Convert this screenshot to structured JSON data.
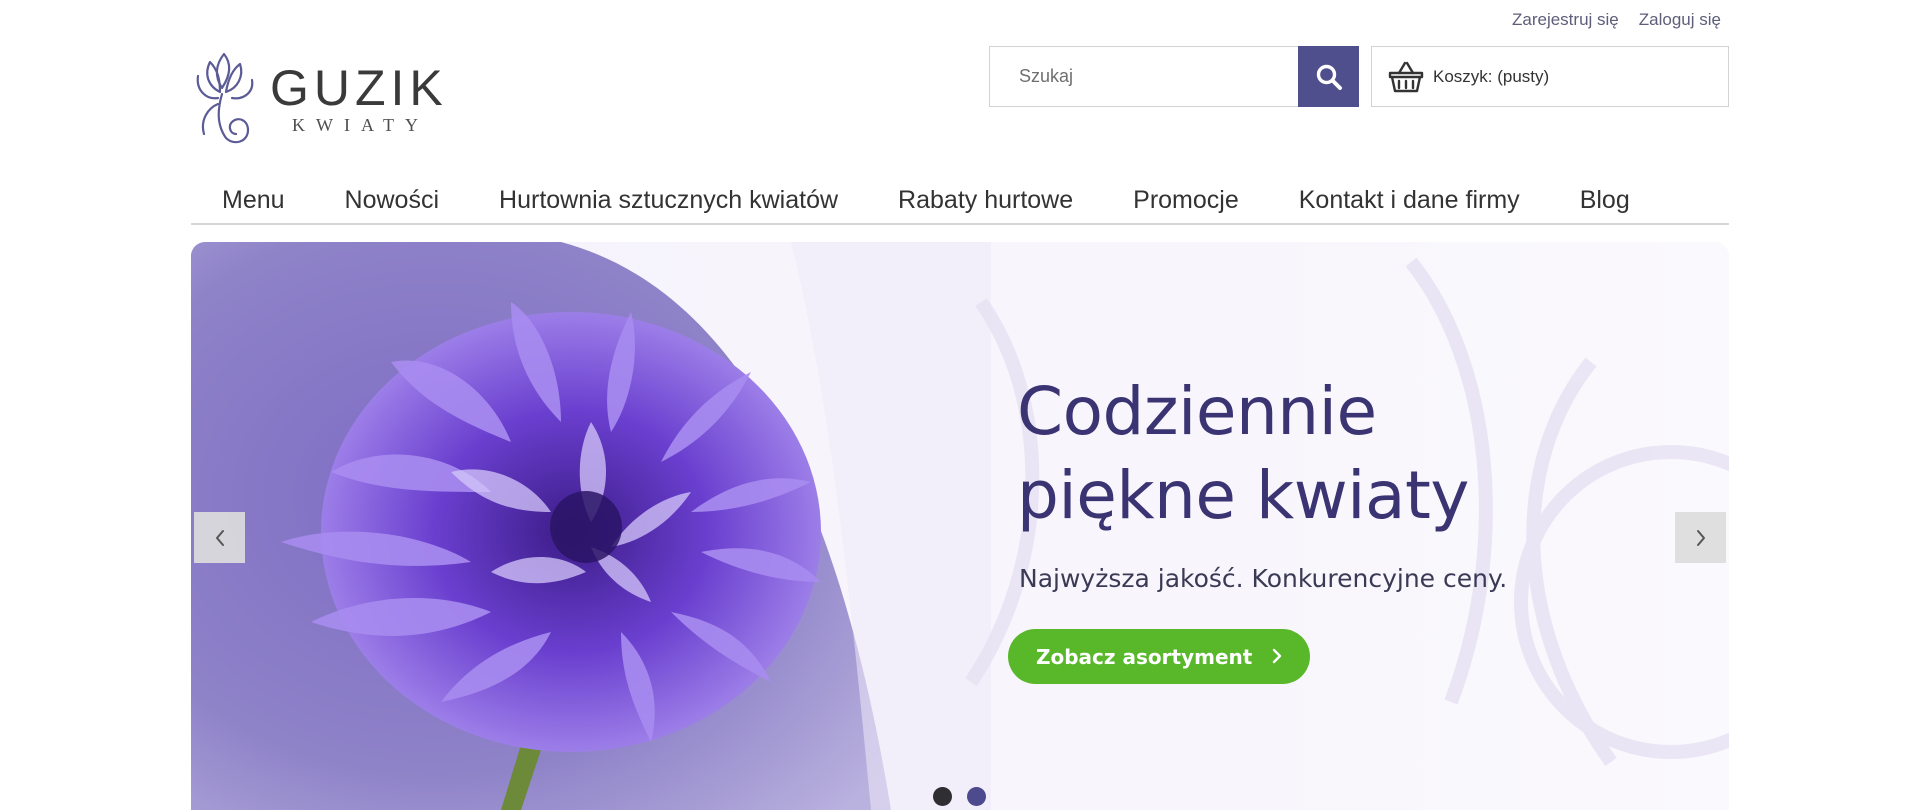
{
  "header": {
    "register_label": "Zarejestruj się",
    "login_label": "Zaloguj się"
  },
  "logo": {
    "title": "GUZIK",
    "subtitle": "KWIATY"
  },
  "search": {
    "placeholder": "Szukaj",
    "value": ""
  },
  "cart": {
    "label": "Koszyk: (pusty)"
  },
  "nav": {
    "items": [
      {
        "label": "Menu"
      },
      {
        "label": "Nowości"
      },
      {
        "label": "Hurtownia sztucznych kwiatów"
      },
      {
        "label": "Rabaty hurtowe"
      },
      {
        "label": "Promocje"
      },
      {
        "label": "Kontakt i dane firmy"
      },
      {
        "label": "Blog"
      }
    ]
  },
  "slider": {
    "headline_line1": "Codziennie",
    "headline_line2": "piękne kwiaty",
    "tagline": "Najwyższa jakość. Konkurencyjne ceny.",
    "cta_label": "Zobacz asortyment",
    "active_slide": 2,
    "slide_count": 2
  },
  "colors": {
    "brand_purple": "#4f4f8e",
    "headline": "#3b3473",
    "cta_green": "#58b829"
  },
  "icons": {
    "search": "search-icon",
    "cart": "basket-icon",
    "prev": "chevron-left-icon",
    "next": "chevron-right-icon"
  }
}
